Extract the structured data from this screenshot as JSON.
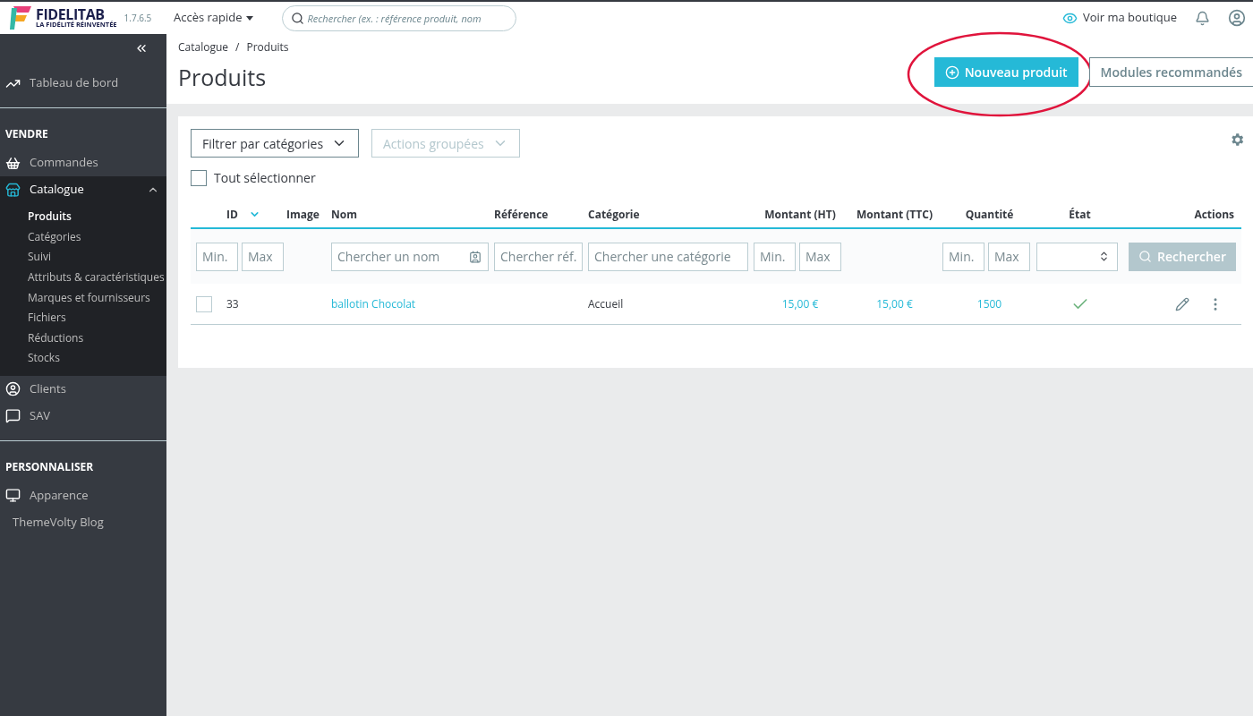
{
  "topbar": {
    "logo": {
      "name": "FIDELITAB",
      "tagline": "LA FIDÉLITÉ RÉINVENTÉE"
    },
    "version": "1.7.6.5",
    "quick_access": "Accès rapide",
    "search": {
      "placeholder": "Rechercher (ex. : référence produit, nom"
    },
    "shop_link": "Voir ma boutique"
  },
  "sidebar": {
    "groups": [
      {
        "items": [
          {
            "kind": "icon",
            "label": "Tableau de bord",
            "selected": false
          }
        ]
      },
      {
        "heading": "VENDRE",
        "items": [
          {
            "kind": "icon",
            "label": "Commandes",
            "selected": false
          },
          {
            "kind": "icon",
            "label": "Catalogue",
            "selected": true,
            "expanded": true,
            "children": [
              {
                "label": "Produits",
                "selected": true
              },
              {
                "label": "Catégories",
                "selected": false
              },
              {
                "label": "Suivi",
                "selected": false
              },
              {
                "label": "Attributs & caractéristiques",
                "selected": false
              },
              {
                "label": "Marques et fournisseurs",
                "selected": false
              },
              {
                "label": "Fichiers",
                "selected": false
              },
              {
                "label": "Réductions",
                "selected": false
              },
              {
                "label": "Stocks",
                "selected": false
              }
            ]
          },
          {
            "kind": "icon",
            "label": "Clients",
            "selected": false
          },
          {
            "kind": "icon",
            "label": "SAV",
            "selected": false
          }
        ]
      },
      {
        "heading": "PERSONNALISER",
        "items": [
          {
            "kind": "icon",
            "label": "Apparence",
            "selected": false
          },
          {
            "kind": "plain",
            "label": "ThemeVolty Blog",
            "selected": false
          }
        ]
      }
    ]
  },
  "breadcrumb": [
    {
      "label": "Catalogue",
      "separator": "/"
    },
    {
      "label": "Produits"
    }
  ],
  "page_title": "Produits",
  "header_buttons": [
    {
      "kind": "primary",
      "label": "Nouveau produit",
      "highlighted": true
    },
    {
      "kind": "outline",
      "label": "Modules recommandés",
      "highlighted": false
    }
  ],
  "toolbar": {
    "category_filter": {
      "label": "Filtrer par catégories",
      "disabled": false
    },
    "bulk_actions": {
      "label": "Actions groupées",
      "disabled": true
    },
    "select_all": {
      "label": "Tout sélectionner",
      "checked": false
    }
  },
  "table": {
    "columns": [
      {
        "label": "ID",
        "sorted": true
      },
      {
        "label": "Image"
      },
      {
        "label": "Nom"
      },
      {
        "label": "Référence"
      },
      {
        "label": "Catégorie"
      },
      {
        "label": "Montant (HT)"
      },
      {
        "label": "Montant (TTC)"
      },
      {
        "label": "Quantité"
      },
      {
        "label": "État"
      },
      {
        "label": "Actions"
      }
    ],
    "filters": [
      {
        "kind": "range",
        "fields": [
          {
            "placeholder": "Min."
          },
          {
            "placeholder": "Max"
          }
        ]
      },
      {
        "kind": "none"
      },
      {
        "kind": "text",
        "placeholder": "Chercher un nom"
      },
      {
        "kind": "text",
        "placeholder": "Chercher réf."
      },
      {
        "kind": "text",
        "placeholder": "Chercher une catégorie"
      },
      {
        "kind": "range",
        "fields": [
          {
            "placeholder": "Min."
          },
          {
            "placeholder": "Max"
          }
        ]
      },
      {
        "kind": "none"
      },
      {
        "kind": "range",
        "fields": [
          {
            "placeholder": "Min."
          },
          {
            "placeholder": "Max"
          }
        ]
      },
      {
        "kind": "select"
      },
      {
        "kind": "button",
        "label": "Rechercher",
        "disabled": true
      }
    ],
    "rows": [
      {
        "checked": false,
        "id": "33",
        "name": "ballotin Chocolat",
        "category": "Accueil",
        "price_ht": "15,00 €",
        "price_ttc": "15,00 €",
        "quantity": "1500",
        "active": true
      }
    ]
  }
}
